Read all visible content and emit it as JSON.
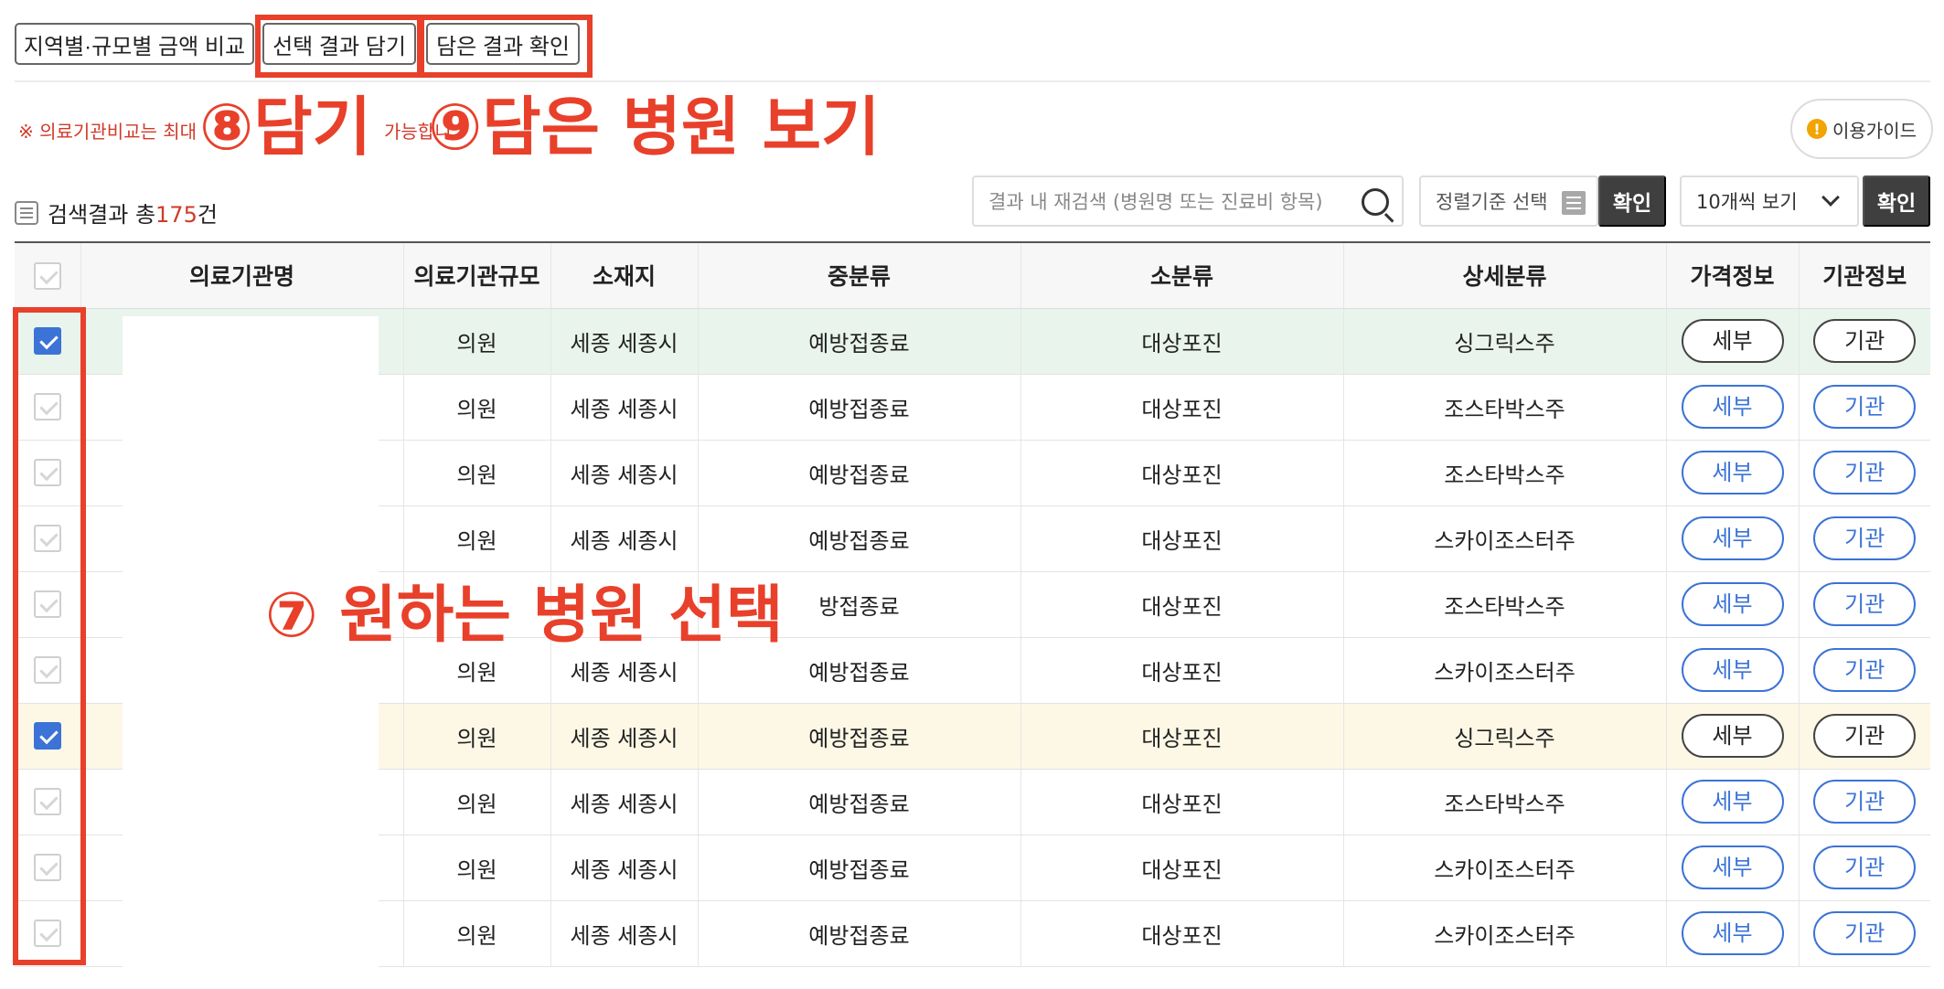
{
  "top_buttons": {
    "compare": "지역별·규모별 금액 비교",
    "add_selected": "선택 결과 담기",
    "view_added": "담은 결과 확인"
  },
  "notice": "※ 의료기관비교는 최대",
  "notice_tail": "가능합니",
  "annotations": {
    "step8": "⑧담기",
    "step9": "⑨담은 병원 보기",
    "step7": "⑦ 원하는 병원 선택",
    "color": "#e8402a"
  },
  "guide_button": {
    "icon": "!",
    "label": "이용가이드"
  },
  "result_count": {
    "prefix": "검색결과 총",
    "count": "175",
    "suffix": "건"
  },
  "search": {
    "placeholder": "결과 내 재검색 (병원명 또는 진료비 항목)"
  },
  "sort": {
    "label": "정렬기준 선택"
  },
  "confirm_label": "확인",
  "per_page": {
    "selected": "10개씩 보기"
  },
  "table": {
    "headers": [
      "의료기관명",
      "의료기관규모",
      "소재지",
      "중분류",
      "소분류",
      "상세분류",
      "가격정보",
      "기관정보"
    ],
    "rows": [
      {
        "checked": true,
        "highlight": "green",
        "size": "의원",
        "location": "세종 세종시",
        "mid": "예방접종료",
        "small": "대상포진",
        "detail": "싱그릭스주",
        "price_btn": "세부",
        "inst_btn": "기관"
      },
      {
        "checked": false,
        "highlight": "",
        "size": "의원",
        "location": "세종 세종시",
        "mid": "예방접종료",
        "small": "대상포진",
        "detail": "조스타박스주",
        "price_btn": "세부",
        "inst_btn": "기관"
      },
      {
        "checked": false,
        "highlight": "",
        "size": "의원",
        "location": "세종 세종시",
        "mid": "예방접종료",
        "small": "대상포진",
        "detail": "조스타박스주",
        "price_btn": "세부",
        "inst_btn": "기관"
      },
      {
        "checked": false,
        "highlight": "",
        "size": "의원",
        "location": "세종 세종시",
        "mid": "예방접종료",
        "small": "대상포진",
        "detail": "스카이조스터주",
        "price_btn": "세부",
        "inst_btn": "기관"
      },
      {
        "checked": false,
        "highlight": "",
        "size": "",
        "location": "",
        "mid": "방접종료",
        "small": "대상포진",
        "detail": "조스타박스주",
        "price_btn": "세부",
        "inst_btn": "기관"
      },
      {
        "checked": false,
        "highlight": "",
        "size": "의원",
        "location": "세종 세종시",
        "mid": "예방접종료",
        "small": "대상포진",
        "detail": "스카이조스터주",
        "price_btn": "세부",
        "inst_btn": "기관"
      },
      {
        "checked": true,
        "highlight": "yellow",
        "size": "의원",
        "location": "세종 세종시",
        "mid": "예방접종료",
        "small": "대상포진",
        "detail": "싱그릭스주",
        "price_btn": "세부",
        "inst_btn": "기관"
      },
      {
        "checked": false,
        "highlight": "",
        "size": "의원",
        "location": "세종 세종시",
        "mid": "예방접종료",
        "small": "대상포진",
        "detail": "조스타박스주",
        "price_btn": "세부",
        "inst_btn": "기관"
      },
      {
        "checked": false,
        "highlight": "",
        "size": "의원",
        "location": "세종 세종시",
        "mid": "예방접종료",
        "small": "대상포진",
        "detail": "스카이조스터주",
        "price_btn": "세부",
        "inst_btn": "기관"
      },
      {
        "checked": false,
        "highlight": "",
        "size": "의원",
        "location": "세종 세종시",
        "mid": "예방접종료",
        "small": "대상포진",
        "detail": "스카이조스터주",
        "price_btn": "세부",
        "inst_btn": "기관"
      }
    ]
  },
  "colors": {
    "accent_blue": "#3b73d6",
    "dark_button": "#3f3f3f",
    "red_count": "#d23a2a"
  }
}
